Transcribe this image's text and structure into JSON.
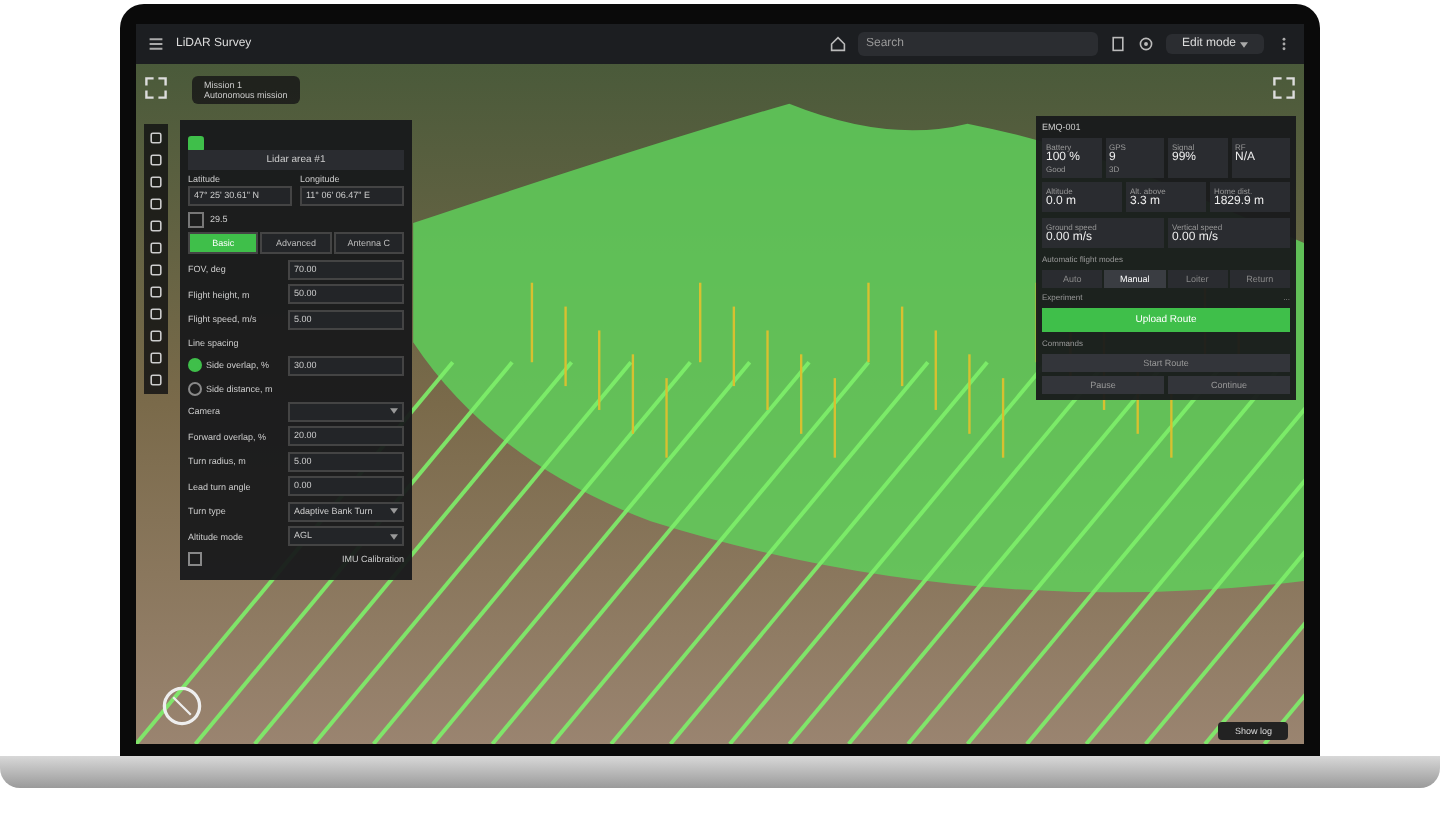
{
  "header": {
    "title": "LiDAR Survey",
    "search_placeholder": "Search",
    "mode": "Edit mode"
  },
  "map_chip": {
    "title": "Mission 1",
    "subtitle": "Autonomous mission"
  },
  "left_panel": {
    "title": "Lidar area #1",
    "latitude_label": "Latitude",
    "longitude_label": "Longitude",
    "latitude": "47° 25' 30.61\" N",
    "longitude": "11° 06' 06.47\" E",
    "altitude": "29.5",
    "tabs": [
      {
        "label": "Basic",
        "selected": true
      },
      {
        "label": "Advanced",
        "selected": false
      },
      {
        "label": "Antenna C",
        "selected": false
      }
    ],
    "rows": [
      {
        "kind": "field",
        "label": "FOV, deg",
        "value": "70.00"
      },
      {
        "kind": "field",
        "label": "Flight height, m",
        "value": "50.00"
      },
      {
        "kind": "field",
        "label": "Flight speed, m/s",
        "value": "5.00"
      },
      {
        "kind": "heading",
        "label": "Line spacing"
      },
      {
        "kind": "radio",
        "label": "Side overlap, %",
        "value": "30.00",
        "selected": true
      },
      {
        "kind": "radio",
        "label": "Side distance, m",
        "selected": false
      },
      {
        "kind": "select",
        "label": "Camera",
        "value": ""
      },
      {
        "kind": "field",
        "label": "Forward overlap, %",
        "value": "20.00"
      },
      {
        "kind": "field",
        "label": "Turn radius, m",
        "value": "5.00"
      },
      {
        "kind": "field",
        "label": "Lead turn angle",
        "value": "0.00"
      },
      {
        "kind": "select",
        "label": "Turn type",
        "value": "Adaptive Bank Turn"
      },
      {
        "kind": "select",
        "label": "Altitude mode",
        "value": "AGL"
      },
      {
        "kind": "checkbox",
        "label": "IMU Calibration",
        "checked": false
      }
    ]
  },
  "right_panel": {
    "title": "EMQ-001",
    "stats": [
      {
        "label": "Battery",
        "value": "100 %",
        "sub": "Good"
      },
      {
        "label": "GPS",
        "value": "9",
        "sub": "3D"
      },
      {
        "label": "Signal",
        "value": "99%"
      },
      {
        "label": "RF",
        "value": "N/A"
      }
    ],
    "distances": [
      {
        "label": "Altitude",
        "value": "0.0 m"
      },
      {
        "label": "Alt. above",
        "value": "3.3 m"
      },
      {
        "label": "Home dist.",
        "value": "1829.9 m"
      }
    ],
    "speeds": [
      {
        "label": "Ground speed",
        "value": "0.00 m/s"
      },
      {
        "label": "Vertical speed",
        "value": "0.00 m/s"
      }
    ],
    "modes_label": "Automatic flight modes",
    "modes": [
      {
        "label": "Auto",
        "selected": false
      },
      {
        "label": "Manual",
        "selected": true
      },
      {
        "label": "Loiter",
        "selected": false
      },
      {
        "label": "Return",
        "selected": false
      }
    ],
    "experiment": {
      "label": "Experiment",
      "value": "..."
    },
    "upload_button": "Upload Route",
    "commands_label": "Commands",
    "start_button": "Start Route",
    "actions": [
      "Pause",
      "Continue"
    ]
  },
  "show_log": "Show log"
}
